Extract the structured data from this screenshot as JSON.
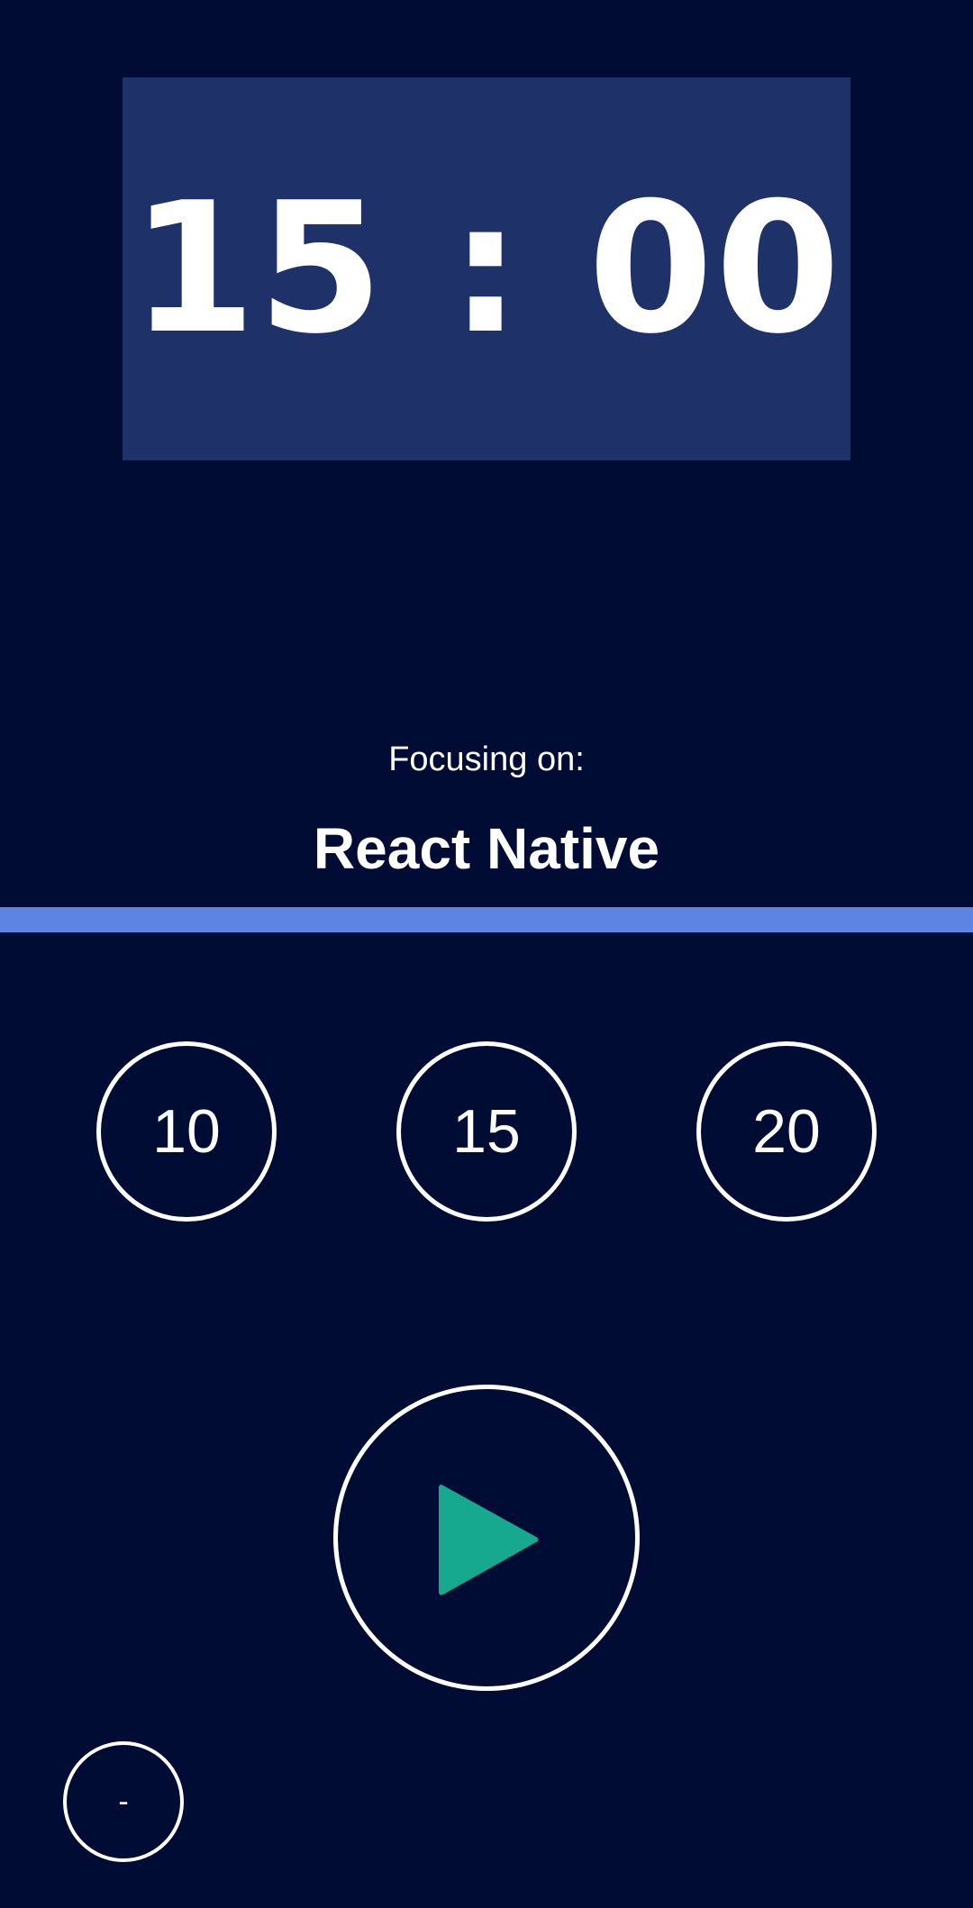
{
  "timer": {
    "display": "15 : 00"
  },
  "focus": {
    "label": "Focusing on:",
    "subject": "React Native"
  },
  "progress": {
    "value": 1.0
  },
  "time_options": [
    "10",
    "15",
    "20"
  ],
  "controls": {
    "play_icon": "play-icon",
    "minus_label": "-"
  },
  "colors": {
    "background": "#000c33",
    "timer_panel": "#1e3169",
    "progress": "#5e84e2",
    "play_icon": "#16a98f"
  }
}
